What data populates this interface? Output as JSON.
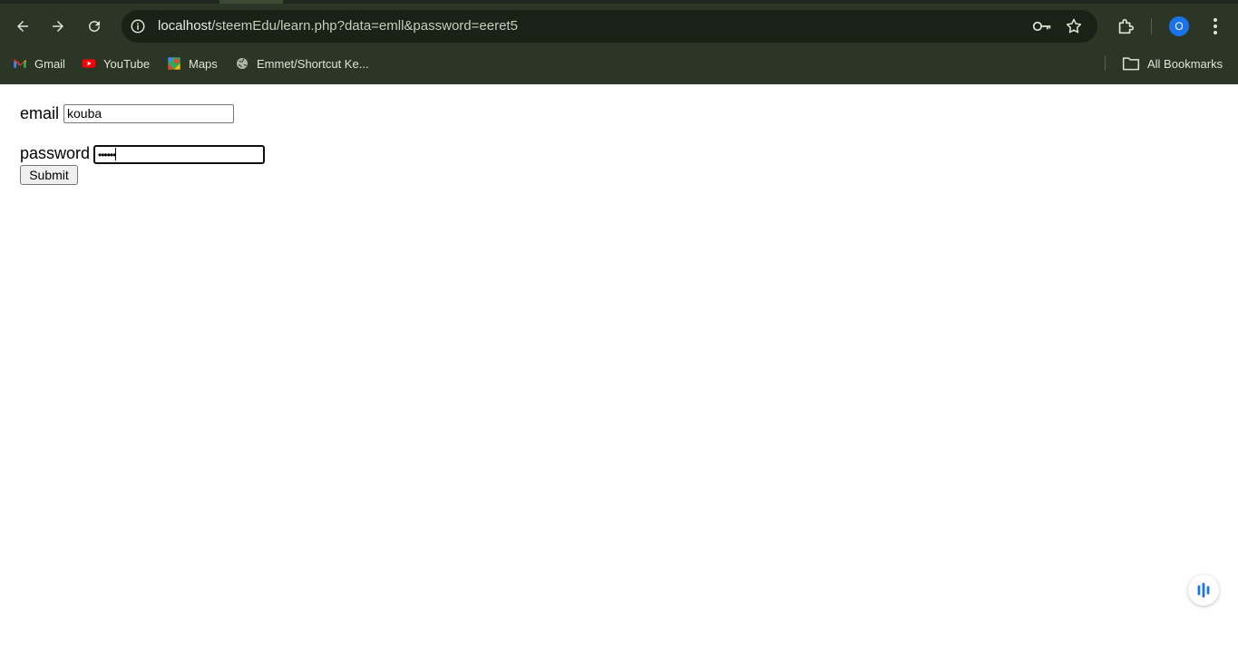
{
  "browser": {
    "url_host": "localhost",
    "url_rest": "/steemEdu/learn.php?data=emll&password=eeret5",
    "avatar_letter": "O",
    "colors": {
      "chrome": "#2b3626",
      "omnibox": "#1a2117",
      "avatar": "#1a73e8"
    }
  },
  "bookmarks": {
    "items": [
      {
        "label": "Gmail",
        "icon": "gmail-icon"
      },
      {
        "label": "YouTube",
        "icon": "youtube-icon"
      },
      {
        "label": "Maps",
        "icon": "maps-icon"
      },
      {
        "label": "Emmet/Shortcut Ke...",
        "icon": "globe-icon"
      }
    ],
    "all_bookmarks_label": "All Bookmarks"
  },
  "form": {
    "email_label": "email",
    "email_value": "kouba",
    "password_label": "password",
    "password_mask": "••••••",
    "submit_label": "Submit"
  }
}
